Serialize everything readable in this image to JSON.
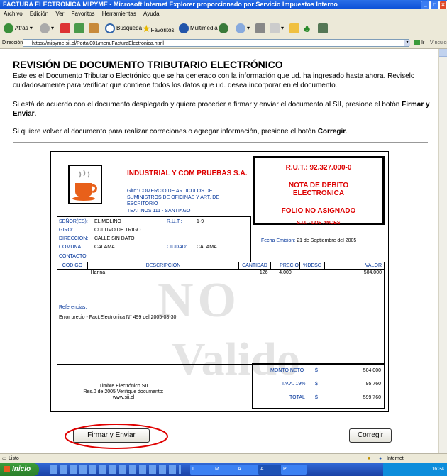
{
  "window": {
    "title": "FACTURA ELECTRONICA MIPYME - Microsoft Internet Explorer proporcionado por Servicio Impuestos Interno"
  },
  "menu": [
    "Archivo",
    "Edición",
    "Ver",
    "Favoritos",
    "Herramientas",
    "Ayuda"
  ],
  "toolbar": {
    "back": "Atrás",
    "search": "Búsqueda",
    "favorites": "Favoritos",
    "multimedia": "Multimedia"
  },
  "address": {
    "label": "Dirección",
    "url": "https://mipyme.sii.cl/Portal001/menuFacturaElectronica.html",
    "go": "Ir",
    "links": "Vínculos"
  },
  "page": {
    "title": "REVISIÓN DE DOCUMENTO TRIBUTARIO ELECTRÓNICO",
    "p1": "Este es el Documento Tributario Electrónico que se ha generado con la información que ud. ha ingresado hasta ahora. Reviselo cuidadosamente para verificar que contiene todos los datos que ud. desea incorporar en el documento.",
    "p2_a": "Si está de acuerdo con el documento desplegado y quiere proceder a firmar y enviar el documento al SII, presione el botón ",
    "p2_b": "Firmar y Enviar",
    "p2_c": ".",
    "p3_a": "Si quiere volver al documento para realizar correciones o agregar información, presione el botón ",
    "p3_b": "Corregir",
    "p3_c": "."
  },
  "doc": {
    "company": "INDUSTRIAL Y COM PRUEBAS S.A.",
    "giro": "Giro: COMERCIO DE ARTICULOS DE SUMINISTROS DE OFICINAS Y ART. DE ESCRITORIO",
    "address": "TEATINOS 111 - SANTIAGO",
    "rut": "R.U.T.: 92.327.000-0",
    "doc_type": "NOTA DE DEBITO ELECTRONICA",
    "folio": "FOLIO NO ASIGNADO",
    "sii": "S.I.I. - LOS ANDES",
    "fecha_label": "Fecha Emision:",
    "fecha": "21 de Septiembre del 2005",
    "senores_label": "SEÑOR(ES):",
    "senores": "EL MOLINO",
    "rut_label": "R.U.T.:",
    "rut_cliente": "1-9",
    "giro_label": "GIRO:",
    "giro_cliente": "CULTIVO DE TRIGO",
    "direccion_label": "DIRECCION:",
    "direccion": "CALLE SIN DATO",
    "comuna_label": "COMUNA",
    "comuna": "CALAMA",
    "ciudad_label": "CIUDAD:",
    "ciudad": "CALAMA",
    "contacto_label": "CONTACTO:",
    "columns": [
      "CODIGO",
      "DESCRIPCION",
      "CANTIDAD",
      "PRECIO",
      "%DESC",
      "VALOR"
    ],
    "item": {
      "codigo": "",
      "descripcion": "Harina",
      "cantidad": "126",
      "precio": "4.000",
      "desc": "",
      "valor": "504.000"
    },
    "referencias_label": "Referencias:",
    "referencia": "Error precio - Fact.Electronica N° 499 del 2005-08-30",
    "watermark_1": "NO",
    "watermark_2": "Valido",
    "timbre_1": "Timbre Electrónico SII",
    "timbre_2": "Res.0 de 2005 Verifique documento:",
    "timbre_3": "www.sii.cl",
    "monto_neto_label": "MONTO NETO",
    "iva_label": "I.V.A. 19%",
    "total_label": "TOTAL",
    "currency": "$",
    "monto_neto": "504.000",
    "iva": "95.760",
    "total": "599.760"
  },
  "buttons": {
    "firmar": "Firmar y Enviar",
    "corregir": "Corregir"
  },
  "status": {
    "left": "Listo",
    "zone": "Internet"
  },
  "taskbar": {
    "start": "Inicio",
    "time": "16:34",
    "tasks": [
      "L",
      "M",
      "A",
      "A",
      "P."
    ]
  },
  "colors": {
    "doc_red": "#dd0000",
    "doc_blue": "#003399",
    "highlight": "#e00000",
    "titlebar": "#0b4fd6"
  }
}
